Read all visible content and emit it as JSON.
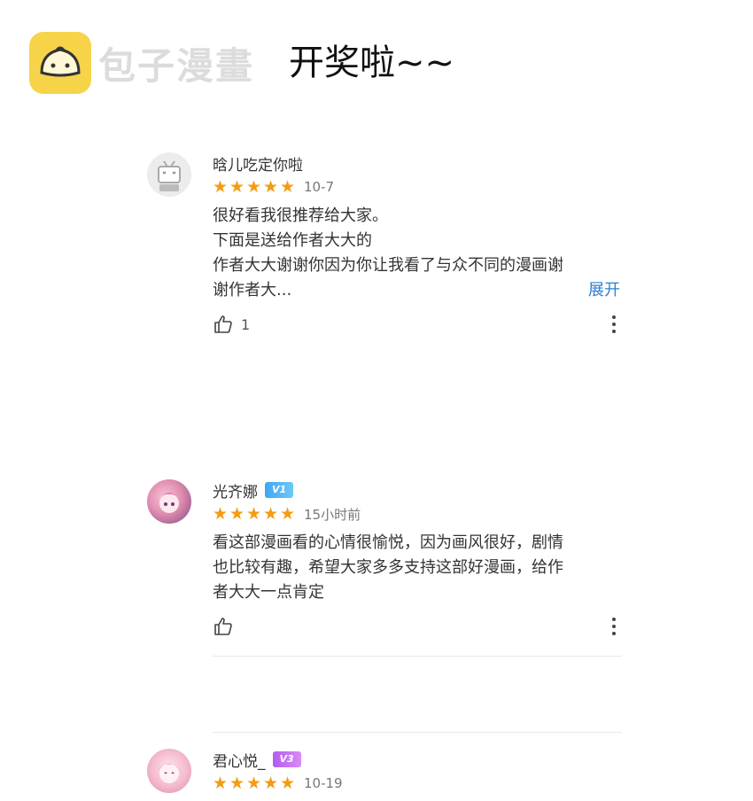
{
  "watermark": {
    "text": "包子漫畫"
  },
  "title": "开奖啦~~",
  "comments": [
    {
      "username": "晗儿吃定你啦",
      "badge": "",
      "stars": 5,
      "date": "10-7",
      "lines": [
        "很好看我很推荐给大家。",
        "下面是送给作者大大的",
        "作者大大谢谢你因为你让我看了与众不同的漫画谢",
        "谢作者大..."
      ],
      "expand_label": "展开",
      "likes": "1"
    },
    {
      "username": "光齐娜",
      "badge": "V1",
      "stars": 5,
      "date": "15小时前",
      "lines": [
        "看这部漫画看的心情很愉悦，因为画风很好，剧情",
        "也比较有趣，希望大家多多支持这部好漫画，给作",
        "者大大一点肯定"
      ],
      "likes": ""
    },
    {
      "username": "君心悦_",
      "badge": "V3",
      "stars": 5,
      "date": "10-19"
    }
  ],
  "colors": {
    "star": "#f39c12",
    "link": "#2c7fd6",
    "badge_v1": "#3fa7f4",
    "badge_v3": "#b35cf0"
  }
}
